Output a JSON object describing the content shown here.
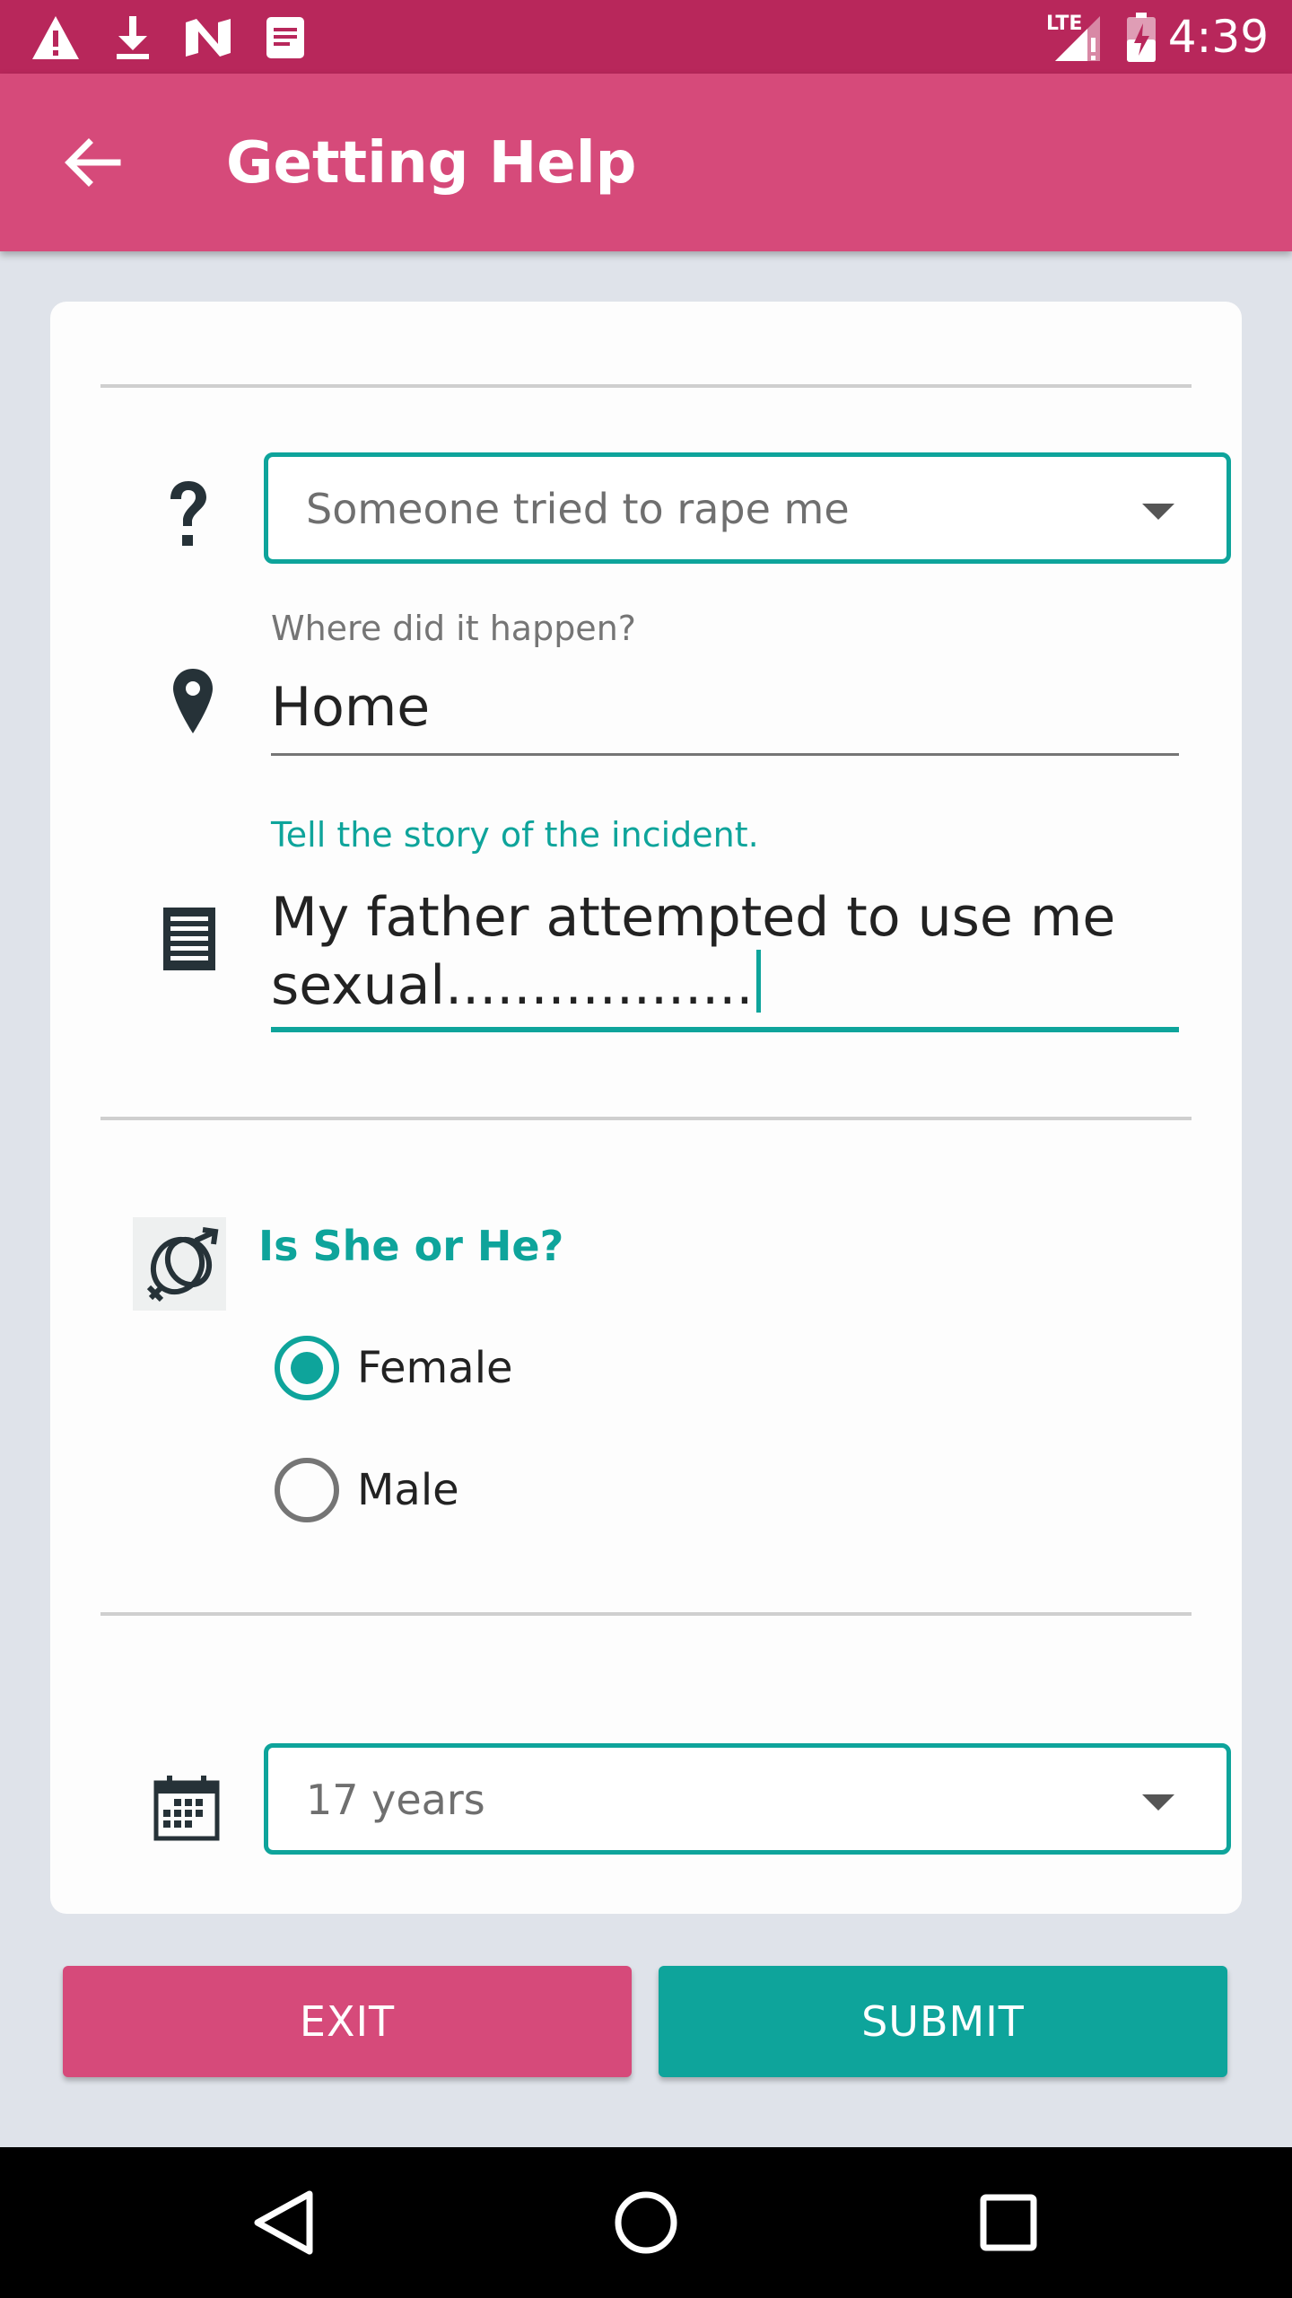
{
  "status_bar": {
    "time": "4:39",
    "network": "LTE"
  },
  "app_bar": {
    "title": "Getting Help"
  },
  "form": {
    "incident_type": {
      "value": "Someone tried to rape me"
    },
    "location": {
      "label": "Where did it happen?",
      "value": "Home"
    },
    "story": {
      "label": "Tell the story of the incident.",
      "line1": "My father attempted to use me",
      "line2": "sexual.................."
    },
    "gender": {
      "label": "Is She or He?",
      "options": [
        {
          "label": "Female",
          "selected": true
        },
        {
          "label": "Male",
          "selected": false
        }
      ]
    },
    "age": {
      "value": "17 years"
    }
  },
  "buttons": {
    "exit_label": "EXIT",
    "submit_label": "SUBMIT"
  },
  "colors": {
    "primary": "#d64a7a",
    "primary_dark": "#b8275b",
    "accent": "#0ea49b",
    "exit_button": "#d64a7a",
    "submit_button": "#0ea49b"
  }
}
